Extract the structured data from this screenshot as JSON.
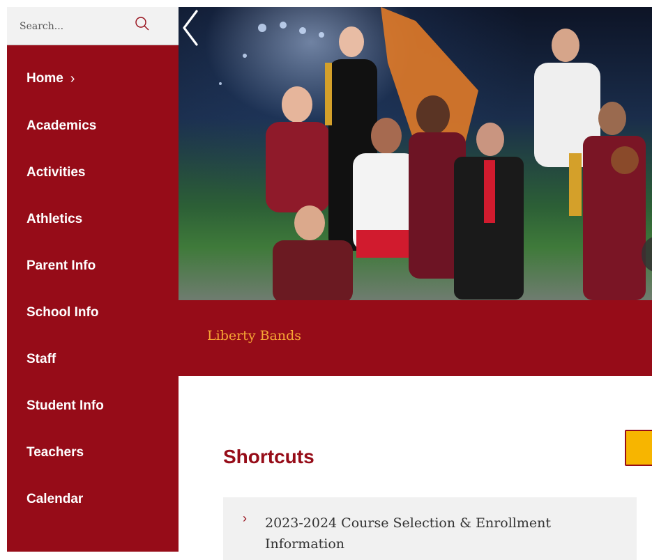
{
  "search": {
    "placeholder": "Search..."
  },
  "nav": {
    "items": [
      {
        "label": "Home",
        "chevron": "›"
      },
      {
        "label": "Academics"
      },
      {
        "label": "Activities"
      },
      {
        "label": "Athletics"
      },
      {
        "label": "Parent Info"
      },
      {
        "label": "School Info"
      },
      {
        "label": "Staff"
      },
      {
        "label": "Student Info"
      },
      {
        "label": "Teachers"
      },
      {
        "label": "Calendar"
      }
    ]
  },
  "hero": {
    "prev_icon": "chevron-left-icon"
  },
  "caption": {
    "title": "Liberty Bands"
  },
  "shortcuts": {
    "title": "Shortcuts",
    "items": [
      {
        "chevron": "›",
        "label": "2023-2024 Course Selection & Enrollment Information"
      }
    ]
  },
  "colors": {
    "brand": "#960c18",
    "accent": "#f7a635",
    "button": "#f7b500"
  }
}
